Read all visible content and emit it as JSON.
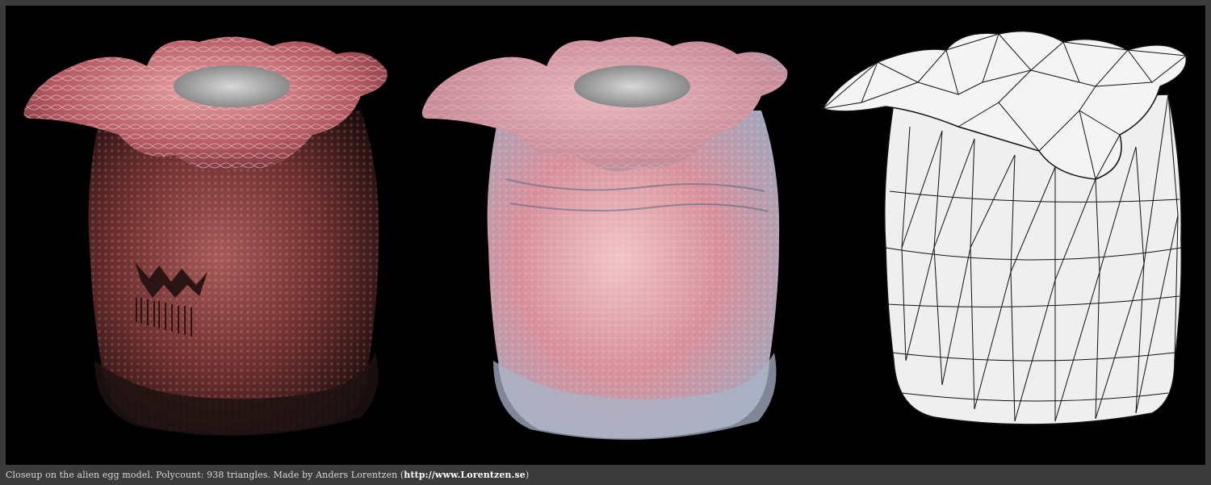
{
  "views": [
    {
      "name": "textured-render"
    },
    {
      "name": "normal-map-render"
    },
    {
      "name": "wireframe-render"
    }
  ],
  "caption": {
    "text": "Closeup on the alien egg model. Polycount: 938 triangles. Made by Anders Lorentzen (",
    "link": "http://www.Lorentzen.se",
    "suffix": ")"
  },
  "colors": {
    "background": "#000000",
    "frame": "#3b3b3b",
    "egg_textured": "#8a3c3c",
    "egg_normal": "#d9a3ad",
    "wireframe_fill": "#f0f0f0",
    "wireframe_line": "#111111"
  }
}
